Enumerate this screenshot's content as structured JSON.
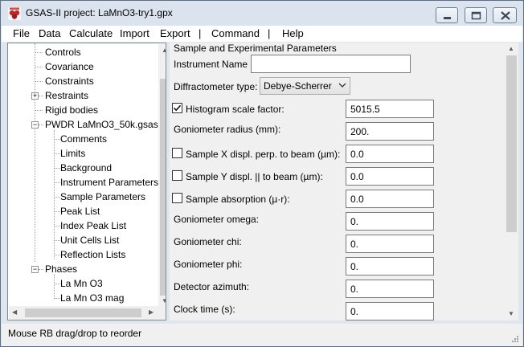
{
  "window": {
    "title": "GSAS-II project: LaMnO3-try1.gpx",
    "controls": [
      "minimize",
      "maximize",
      "close"
    ]
  },
  "menubar": {
    "items": [
      "File",
      "Data",
      "Calculate",
      "Import",
      "Export",
      "|",
      "Command",
      "|",
      "Help"
    ]
  },
  "tree": {
    "items": [
      {
        "label": "Controls",
        "expander": ""
      },
      {
        "label": "Covariance",
        "expander": ""
      },
      {
        "label": "Constraints",
        "expander": ""
      },
      {
        "label": "Restraints",
        "expander": "+"
      },
      {
        "label": "Rigid bodies",
        "expander": ""
      },
      {
        "label": "PWDR LaMnO3_50k.gsas",
        "expander": "−"
      },
      {
        "label": "Comments",
        "expander": ""
      },
      {
        "label": "Limits",
        "expander": ""
      },
      {
        "label": "Background",
        "expander": ""
      },
      {
        "label": "Instrument Parameters",
        "expander": ""
      },
      {
        "label": "Sample Parameters",
        "expander": ""
      },
      {
        "label": "Peak List",
        "expander": ""
      },
      {
        "label": "Index Peak List",
        "expander": ""
      },
      {
        "label": "Unit Cells List",
        "expander": ""
      },
      {
        "label": "Reflection Lists",
        "expander": ""
      },
      {
        "label": "Phases",
        "expander": "−"
      },
      {
        "label": "La Mn O3",
        "expander": ""
      },
      {
        "label": "La Mn O3 mag",
        "expander": ""
      }
    ]
  },
  "sample_params": {
    "heading": "Sample and Experimental Parameters",
    "instrument_name_label": "Instrument Name",
    "instrument_name_value": "",
    "diffractometer_label": "Diffractometer type:",
    "diffractometer_value": "Debye-Scherrer",
    "rows": [
      {
        "label": "Histogram scale factor:",
        "value": "5015.5",
        "checkbox": true,
        "checked": true
      },
      {
        "label": "Goniometer radius (mm):",
        "value": "200.",
        "checkbox": false,
        "checked": false
      },
      {
        "label": "Sample X displ. perp. to beam (µm):",
        "value": "0.0",
        "checkbox": true,
        "checked": false
      },
      {
        "label": "Sample Y displ. || to beam (µm):",
        "value": "0.0",
        "checkbox": true,
        "checked": false
      },
      {
        "label": "Sample absorption (µ·r):",
        "value": "0.0",
        "checkbox": true,
        "checked": false
      },
      {
        "label": "Goniometer omega:",
        "value": "0.",
        "checkbox": false,
        "checked": false
      },
      {
        "label": "Goniometer chi:",
        "value": "0.",
        "checkbox": false,
        "checked": false
      },
      {
        "label": "Goniometer phi:",
        "value": "0.",
        "checkbox": false,
        "checked": false
      },
      {
        "label": "Detector azimuth:",
        "value": "0.",
        "checkbox": false,
        "checked": false
      },
      {
        "label": "Clock time (s):",
        "value": "0.",
        "checkbox": false,
        "checked": false
      }
    ]
  },
  "statusbar": {
    "text": "Mouse RB drag/drop to reorder"
  },
  "icons": {
    "app": "gsas-app-icon",
    "expand": "plus-icon",
    "collapse": "minus-icon",
    "check": "checkmark-icon",
    "dropdown": "chevron-down-icon"
  }
}
